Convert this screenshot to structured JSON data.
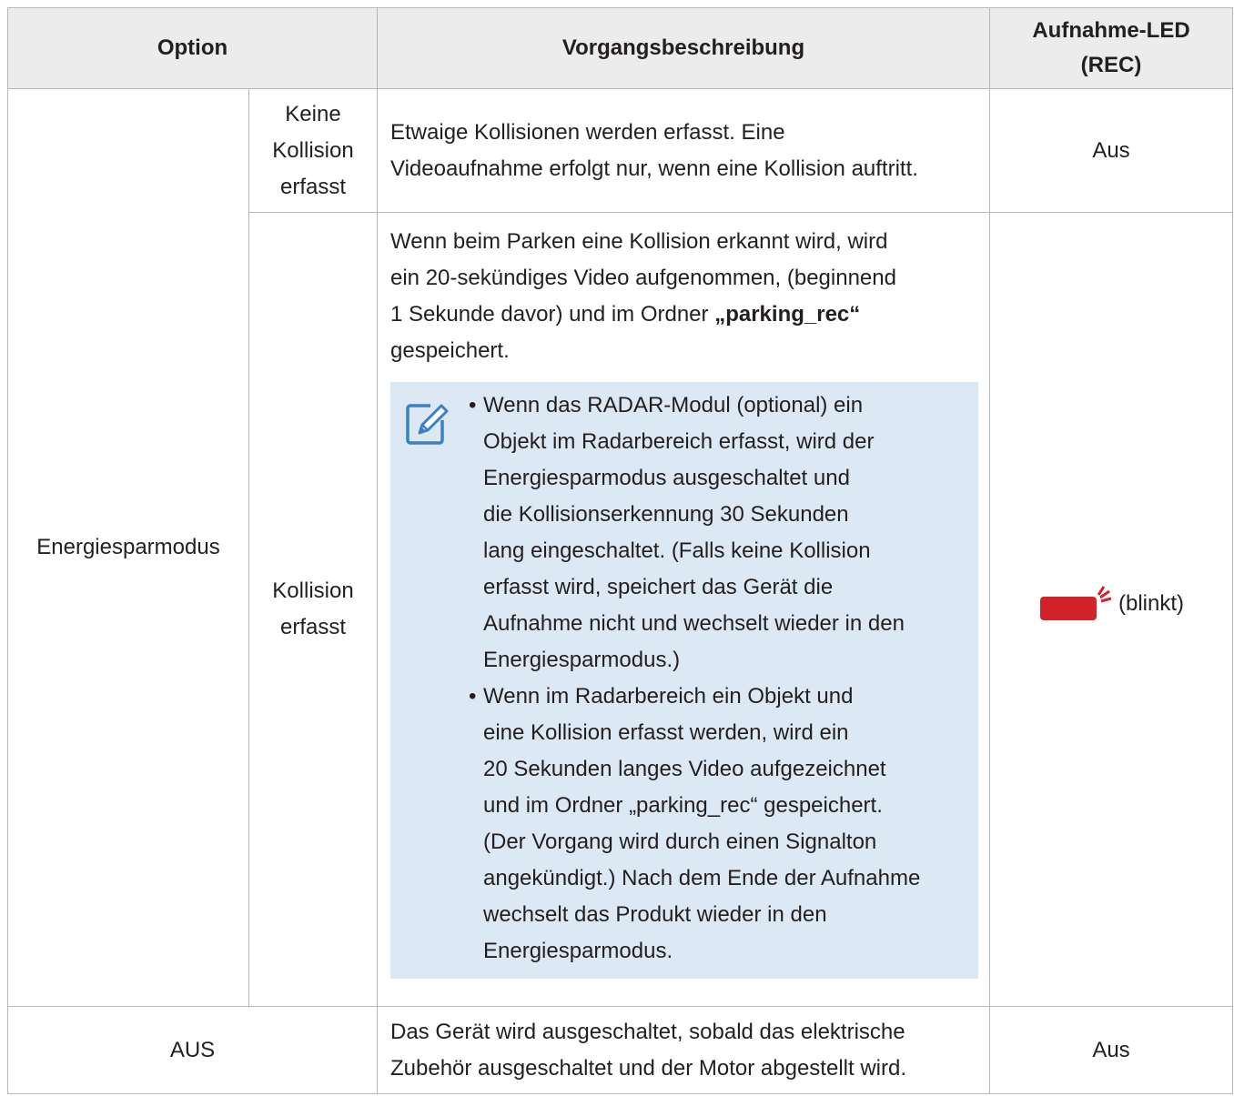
{
  "header": {
    "col_option": "Option",
    "col_description": "Vorgangsbeschreibung",
    "col_led_line1": "Aufnahme-LED",
    "col_led_line2": "(REC)"
  },
  "rows": {
    "energy_mode_label": "Energiesparmodus",
    "no_collision": {
      "sub_label_lines": [
        "Keine",
        "Kollision",
        "erfasst"
      ],
      "desc_lines": [
        "Etwaige Kollisionen werden erfasst. Eine",
        "Videoaufnahme erfolgt nur, wenn eine Kollision auftritt."
      ],
      "led": "Aus"
    },
    "collision": {
      "sub_label_lines": [
        "Kollision",
        "erfasst"
      ],
      "desc_lines": [
        "Wenn beim Parken eine Kollision erkannt wird, wird",
        "ein 20-sekündiges Video aufgenommen, (beginnend",
        "1 Sekunde davor) und im Ordner "
      ],
      "desc_folder": "„parking_rec“",
      "desc_end": "gespeichert.",
      "note_bullet_1": [
        "Wenn das RADAR-Modul (optional) ein",
        "Objekt im Radarbereich erfasst, wird der",
        "Energiesparmodus ausgeschaltet und",
        "die Kollisionserkennung 30 Sekunden",
        "lang eingeschaltet. (Falls keine Kollision",
        "erfasst wird, speichert das Gerät die",
        "Aufnahme nicht und wechselt wieder in den",
        "Energiesparmodus.)"
      ],
      "note_bullet_2": [
        "Wenn im Radarbereich ein Objekt und",
        "eine Kollision erfasst werden, wird ein",
        "20 Sekunden langes Video aufgezeichnet",
        "und im Ordner „parking_rec“ gespeichert.",
        "(Der Vorgang wird durch einen Signalton",
        "angekündigt.) Nach dem Ende der Aufnahme",
        "wechselt das Produkt wieder in den",
        "Energiesparmodus."
      ],
      "led_text": "(blinkt)",
      "led_color": "#d2232a"
    },
    "off": {
      "label": "AUS",
      "desc_lines": [
        "Das Gerät wird ausgeschaltet, sobald das elektrische",
        "Zubehör ausgeschaltet und der Motor abgestellt wird."
      ],
      "led": "Aus"
    }
  },
  "icons": {
    "note": "note-pencil-icon",
    "led": "red-led-blinking-icon"
  },
  "colors": {
    "header_bg": "#ececec",
    "note_bg": "#dce9f5",
    "icon_blue": "#3b7fc4"
  }
}
